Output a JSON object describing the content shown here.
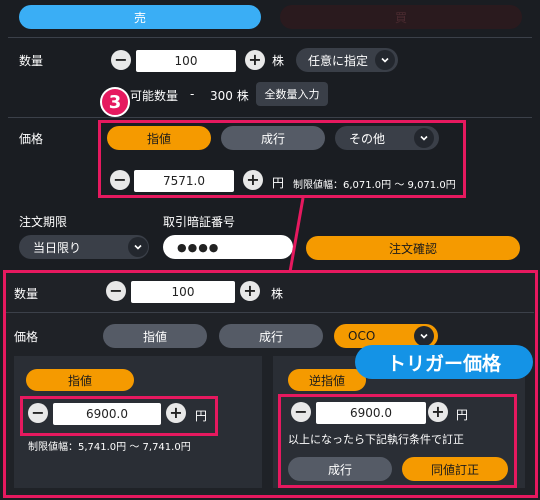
{
  "top": {
    "sell_tab": "売",
    "buy_tab": "買"
  },
  "panel1": {
    "quantity_label": "数量",
    "quantity_value": "100",
    "shares_unit": "株",
    "custom_select": "任意に指定",
    "available_label": "可能数量",
    "available_dash": "-",
    "available_value": "300 株",
    "full_qty_button": "全数量入力",
    "step_badge": "3",
    "price_label": "価格",
    "limit_button": "指値",
    "market_button": "成行",
    "other_select": "その他",
    "price_value": "7571.0",
    "yen_unit": "円",
    "price_range": "制限値幅：6,071.0円 ～ 9,071.0円",
    "expiry_label": "注文期限",
    "expiry_select": "当日限り",
    "pin_label": "取引暗証番号",
    "pin_value": "●●●●",
    "confirm_button": "注文確認"
  },
  "panel2": {
    "quantity_label": "数量",
    "quantity_value": "100",
    "shares_unit": "株",
    "price_label": "価格",
    "limit_button": "指値",
    "market_button": "成行",
    "oco_select": "OCO",
    "trigger_badge": "トリガー価格",
    "left": {
      "limit_tab": "指値",
      "price_value": "6900.0",
      "yen_unit": "円",
      "price_range": "制限値幅：5,741.0円 ～ 7,741.0円"
    },
    "right": {
      "stop_tab": "逆指値",
      "price_value": "6900.0",
      "yen_unit": "円",
      "condition_text": "以上になったら下記執行条件で訂正",
      "market_button": "成行",
      "same_price_button": "同値訂正"
    }
  },
  "colors": {
    "accent_blue": "#3aaef5",
    "accent_orange": "#f59a00",
    "highlight_pink": "#e6195f"
  }
}
